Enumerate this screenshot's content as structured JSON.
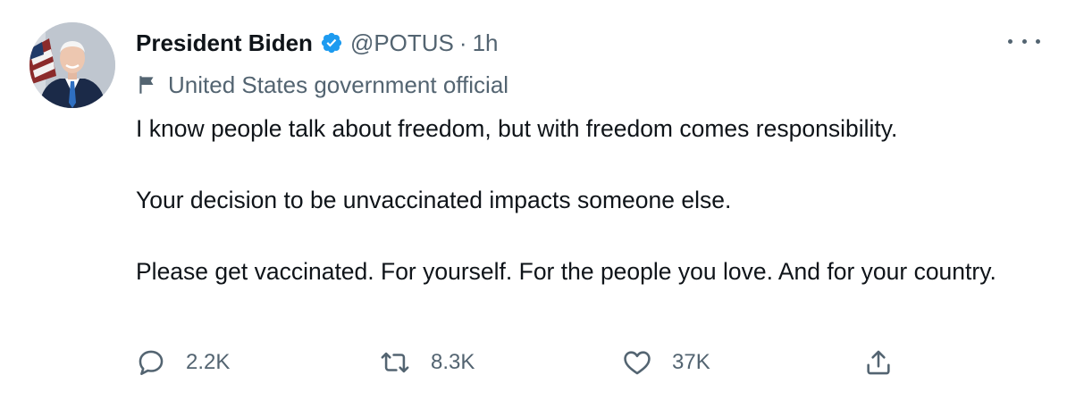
{
  "tweet": {
    "author_name": "President Biden",
    "handle": "@POTUS",
    "separator": "·",
    "time": "1h",
    "label": "United States government official",
    "body": [
      "I know people talk about freedom, but with freedom comes responsibility.",
      "Your decision to be unvaccinated impacts someone else.",
      "Please get vaccinated. For yourself. For the people you love. And for your country."
    ],
    "actions": {
      "replies": "2.2K",
      "retweets": "8.3K",
      "likes": "37K"
    }
  },
  "icons": {
    "verified": "verified-badge-icon",
    "label": "flag-icon",
    "more": "more-dots-icon",
    "reply": "reply-icon",
    "retweet": "retweet-icon",
    "like": "heart-icon",
    "share": "share-icon"
  },
  "colors": {
    "text_primary": "#0f1419",
    "text_secondary": "#536471",
    "verified_blue": "#1d9bf0"
  }
}
